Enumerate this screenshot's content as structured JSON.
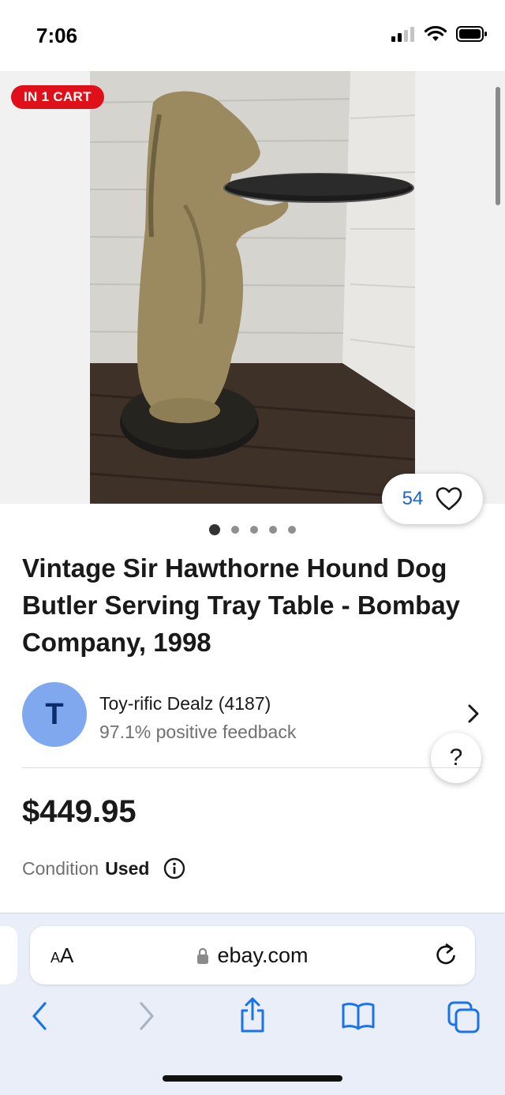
{
  "status": {
    "time": "7:06"
  },
  "gallery": {
    "cart_badge": "IN 1 CART",
    "watch_count": "54",
    "image_count": 5,
    "active_image": 1
  },
  "listing": {
    "title": "Vintage Sir Hawthorne Hound Dog Butler Serving Tray Table - Bombay Company, 1998",
    "price": "$449.95",
    "condition_label": "Condition",
    "condition_value": "Used"
  },
  "seller": {
    "initial": "T",
    "name": "Toy-rific Dealz (4187)",
    "feedback": "97.1% positive feedback"
  },
  "help": {
    "label": "?"
  },
  "browser": {
    "aa_label_small": "A",
    "aa_label_large": "A",
    "url": "ebay.com"
  },
  "icons": {
    "signal": "cellular-signal-icon",
    "wifi": "wifi-icon",
    "battery": "battery-icon",
    "heart": "heart-icon",
    "chevron": "chevron-right-icon",
    "info": "info-icon",
    "lock": "lock-icon",
    "reload": "reload-icon",
    "back": "back-icon",
    "forward": "forward-icon",
    "share": "share-icon",
    "bookmarks": "bookmarks-icon",
    "tabs": "tabs-icon"
  },
  "colors": {
    "accent_blue": "#1a62d6",
    "cart_red": "#e0101b",
    "avatar_bg": "#7fa8ee"
  }
}
